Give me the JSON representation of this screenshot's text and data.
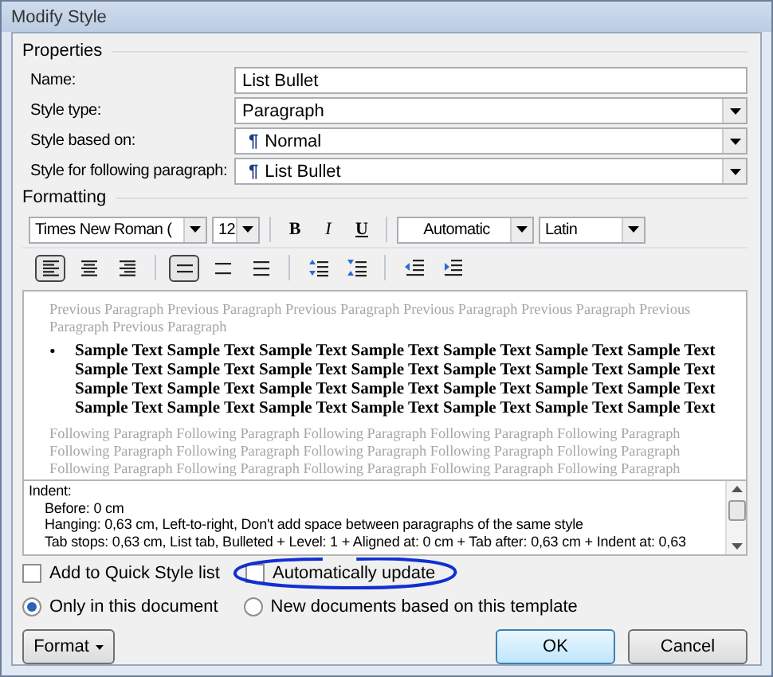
{
  "window": {
    "title": "Modify Style"
  },
  "properties": {
    "heading": "Properties",
    "fields": [
      {
        "label": "Name:",
        "value": "List Bullet",
        "kind": "text"
      },
      {
        "label": "Style type:",
        "value": "Paragraph",
        "kind": "dropdown"
      },
      {
        "label": "Style based on:",
        "value": "Normal",
        "marker": "¶",
        "kind": "dropdown"
      },
      {
        "label": "Style for following paragraph:",
        "value": "List Bullet",
        "marker": "¶",
        "kind": "dropdown"
      }
    ]
  },
  "formatting": {
    "heading": "Formatting",
    "font": "Times New Roman (",
    "size": "12",
    "styles": [
      {
        "kind": "bold",
        "label": "B"
      },
      {
        "kind": "italic",
        "label": "I"
      },
      {
        "kind": "underline",
        "label": "U"
      }
    ],
    "font_color": "Automatic",
    "script": "Latin",
    "alignment": [
      {
        "kind": "left",
        "selected": true
      },
      {
        "kind": "center",
        "selected": false
      },
      {
        "kind": "right",
        "selected": false
      }
    ],
    "line_spacing": [
      {
        "kind": "single",
        "selected": true
      },
      {
        "kind": "one-half",
        "selected": false
      },
      {
        "kind": "double",
        "selected": false
      }
    ],
    "paragraph_spacing": [
      {
        "kind": "increase"
      },
      {
        "kind": "decrease"
      }
    ],
    "indent": [
      {
        "kind": "decrease"
      },
      {
        "kind": "increase"
      }
    ]
  },
  "preview": {
    "previous": "Previous Paragraph Previous Paragraph Previous Paragraph Previous Paragraph Previous Paragraph Previous Paragraph Previous Paragraph",
    "bullet": "•",
    "sample": "Sample Text Sample Text Sample Text Sample Text Sample Text Sample Text Sample Text Sample Text Sample Text Sample Text Sample Text Sample Text Sample Text Sample Text Sample Text Sample Text Sample Text Sample Text Sample Text Sample Text Sample Text Sample Text Sample Text Sample Text Sample Text Sample Text Sample Text Sample Text",
    "following": "Following Paragraph Following Paragraph Following Paragraph Following Paragraph Following Paragraph Following Paragraph Following Paragraph Following Paragraph Following Paragraph Following Paragraph Following Paragraph Following Paragraph Following Paragraph Following Paragraph Following Paragraph"
  },
  "description": [
    "Indent:",
    "Before:  0 cm",
    "Hanging:  0,63 cm, Left-to-right, Don't add space between paragraphs of the same style",
    "Tab stops:  0,63 cm, List tab, Bulleted + Level: 1 + Aligned at:  0 cm + Tab after:  0,63 cm + Indent at:  0,63"
  ],
  "checkboxes": [
    {
      "label": "Add to Quick Style list",
      "checked": false
    },
    {
      "label": "Automatically update",
      "checked": false
    }
  ],
  "radios": [
    {
      "label": "Only in this document",
      "selected": true
    },
    {
      "label": "New documents based on this template",
      "selected": false
    }
  ],
  "buttons": {
    "format": "Format",
    "ok": "OK",
    "cancel": "Cancel"
  }
}
